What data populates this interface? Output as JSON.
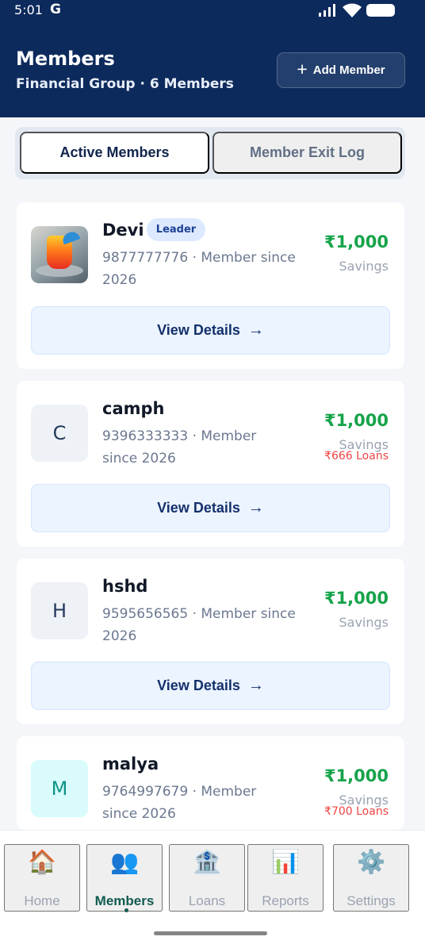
{
  "status_bar": {
    "time": "5:01",
    "google_glyph": "G"
  },
  "header": {
    "title": "Members",
    "subtitle": "Financial Group · 6 Members",
    "add_button_label": "Add Member"
  },
  "tabs": [
    {
      "label": "Active Members",
      "active": true
    },
    {
      "label": "Member Exit Log",
      "active": false
    }
  ],
  "members": [
    {
      "name": "Devi",
      "badge": "Leader",
      "meta": "9877777776 · Member since 2026",
      "amount": "₹1,000",
      "savings_label": "Savings",
      "loans": "",
      "avatar_type": "photo",
      "button_label": "View Details"
    },
    {
      "name": "camph",
      "badge": "",
      "meta": "9396333333 · Member since 2026",
      "amount": "₹1,000",
      "savings_label": "Savings",
      "loans": "₹666 Loans",
      "avatar_letter": "C",
      "button_label": "View Details"
    },
    {
      "name": "hshd",
      "badge": "",
      "meta": "9595656565 · Member since 2026",
      "amount": "₹1,000",
      "savings_label": "Savings",
      "loans": "",
      "avatar_letter": "H",
      "button_label": "View Details"
    },
    {
      "name": "malya",
      "badge": "",
      "meta": "9764997679 · Member since 2026",
      "amount": "₹1,000",
      "savings_label": "Savings",
      "loans": "₹700 Loans",
      "avatar_letter": "M"
    }
  ],
  "bottom_nav": [
    {
      "label": "Home",
      "icon": "🏠",
      "icon_name": "home-icon"
    },
    {
      "label": "Members",
      "icon": "👥",
      "icon_name": "members-icon",
      "active": true
    },
    {
      "label": "Loans",
      "icon": "🏦",
      "icon_name": "bank-icon"
    },
    {
      "label": "Reports",
      "icon": "📊",
      "icon_name": "reports-icon"
    },
    {
      "label": "Settings",
      "icon": "⚙️",
      "icon_name": "settings-icon"
    }
  ],
  "colors": {
    "header": "#0d2a5c",
    "accent_green": "#16a34a",
    "loan_red": "#ef4444",
    "active_nav": "#115b50"
  },
  "icons": {
    "signal": "signal-icon",
    "wifi": "wifi-icon",
    "battery": "battery-icon",
    "add": "plus-icon",
    "view_details": "arrow-right-icon"
  }
}
